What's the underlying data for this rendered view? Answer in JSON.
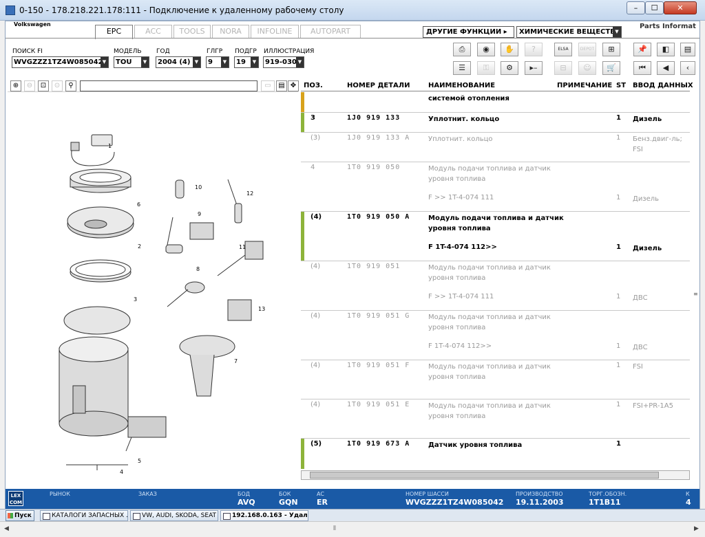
{
  "window": {
    "title": "0-150 - 178.218.221.178:111 - Подключение к удаленному рабочему столу",
    "min_label": "–",
    "max_label": "☐",
    "close_label": "✕"
  },
  "app": {
    "brand": "Volkswagen",
    "tabs": [
      {
        "label": "EPC",
        "active": true
      },
      {
        "label": "ACC",
        "active": false
      },
      {
        "label": "TOOLS",
        "active": false
      },
      {
        "label": "NORA",
        "active": false
      },
      {
        "label": "INFOLINE",
        "active": false
      },
      {
        "label": "AUTOPART",
        "active": false
      }
    ],
    "other_functions": "ДРУГИЕ ФУНКЦИИ ▸",
    "chemicals": "ХИМИЧЕСКИЕ ВЕЩЕСТВА",
    "parts_info": "Parts Informat"
  },
  "filters": {
    "search_label": "ПОИСК FI",
    "search_value": "WVGZZZ1TZ4W085042",
    "model_label": "МОДЕЛЬ",
    "model_value": "TOU",
    "year_label": "ГОД",
    "year_value": "2004 (4)",
    "mg_label": "ГЛГР",
    "mg_value": "9",
    "sg_label": "ПОДГР",
    "sg_value": "19",
    "illus_label": "ИЛЛЮСТРАЦИЯ",
    "illus_value": "919-030"
  },
  "toolbar": {
    "row1": [
      "printer",
      "cd",
      "hand-tools",
      "help",
      "elsa",
      "depot",
      "cart-add",
      "pin",
      "prev-page",
      "next-page"
    ],
    "row2": [
      "list",
      "key",
      "bike",
      "separator",
      "tree",
      "children",
      "cart",
      "first",
      "back",
      "left"
    ]
  },
  "illustration": {
    "callouts": [
      "1",
      "6",
      "2",
      "3",
      "4",
      "5",
      "7",
      "8",
      "9",
      "10",
      "11",
      "12",
      "13"
    ]
  },
  "table": {
    "headers": {
      "pos": "ПОЗ.",
      "part": "НОМЕР ДЕТАЛИ",
      "name": "НАИМЕНОВАНИЕ",
      "note": "ПРИМЕЧАНИЕ",
      "st": "ST",
      "data": "ВВОД ДАННЫХ"
    },
    "rows": [
      {
        "pos": "",
        "part": "",
        "name": "системой отопления",
        "note": "",
        "st": "",
        "data": "",
        "style": "bold",
        "bar": "#d8a21b"
      },
      {
        "pos": "3",
        "part": "1J0 919 133",
        "name": "Уплотнит. кольцо",
        "note": "",
        "st": "1",
        "data": "Дизель",
        "style": "bold",
        "bar": "#8db33a"
      },
      {
        "pos": "(3)",
        "part": "1J0 919 133 A",
        "name": "Уплотнит. кольцо",
        "note": "",
        "st": "1",
        "data": "Бенз.двиг-ль;",
        "data2": "FSI",
        "style": "grey",
        "bar": ""
      },
      {
        "pos": "4",
        "part": "1T0 919 050",
        "name": "Модуль подачи топлива и датчик",
        "name2": "уровня топлива",
        "note": "F            >> 1T-4-074 111",
        "st": "1",
        "data": "Дизель",
        "style": "grey",
        "bar": ""
      },
      {
        "pos": "(4)",
        "part": "1T0 919 050 A",
        "name": "Модуль подачи топлива и датчик",
        "name2": "уровня топлива",
        "note": "F 1T-4-074 112>>",
        "st": "1",
        "data": "Дизель",
        "style": "bold",
        "bar": "#8db33a"
      },
      {
        "pos": "(4)",
        "part": "1T0 919 051",
        "name": "Модуль подачи топлива и датчик",
        "name2": "уровня топлива",
        "note": "F            >> 1T-4-074 111",
        "st": "1",
        "data": "ДВС",
        "style": "grey",
        "bar": ""
      },
      {
        "pos": "(4)",
        "part": "1T0 919 051 G",
        "name": "Модуль подачи топлива и датчик",
        "name2": "уровня топлива",
        "note": "F 1T-4-074 112>>",
        "st": "1",
        "data": "ДВС",
        "style": "grey",
        "bar": ""
      },
      {
        "pos": "(4)",
        "part": "1T0 919 051 F",
        "name": "Модуль подачи топлива и датчик",
        "name2": "уровня топлива",
        "note": "",
        "st": "1",
        "data": "FSI",
        "style": "grey",
        "bar": ""
      },
      {
        "pos": "(4)",
        "part": "1T0 919 051 E",
        "name": "Модуль подачи топлива и датчик",
        "name2": "уровня топлива",
        "note": "",
        "st": "1",
        "data": "FSI+PR-1A5",
        "style": "grey",
        "bar": ""
      },
      {
        "pos": "(5)",
        "part": "1T0 919 673 A",
        "name": "Датчик уровня топлива",
        "note": "",
        "st": "1",
        "data": "",
        "style": "bold",
        "bar": "#8db33a"
      }
    ]
  },
  "status": {
    "logo": "LEX\nCOM",
    "market_label": "РЫНОК",
    "order_label": "ЗАКАЗ",
    "engine_label": "БОД",
    "engine_value": "AVQ",
    "gearbox_label": "БОК",
    "gearbox_value": "GQN",
    "ac_label": "AC",
    "ac_value": "ER",
    "chassis_label": "НОМЕР ШАССИ",
    "chassis_value": "WVGZZZ1TZ4W085042",
    "production_label": "ПРОИЗВОДСТВО",
    "production_value": "19.11.2003",
    "brakes_label": "ТОРГ.ОБОЗН.",
    "brakes_value": "1T1B11",
    "extra_label": "К",
    "extra_value": "4"
  },
  "taskbar": {
    "start": "Пуск",
    "tasks": [
      {
        "label": "КАТАЛОГИ ЗАПАСНЫХ ...",
        "active": false
      },
      {
        "label": "VW, AUDI, SKODA, SEAT",
        "active": false
      },
      {
        "label": "192.168.0.163 - Удал...",
        "active": true
      }
    ]
  }
}
